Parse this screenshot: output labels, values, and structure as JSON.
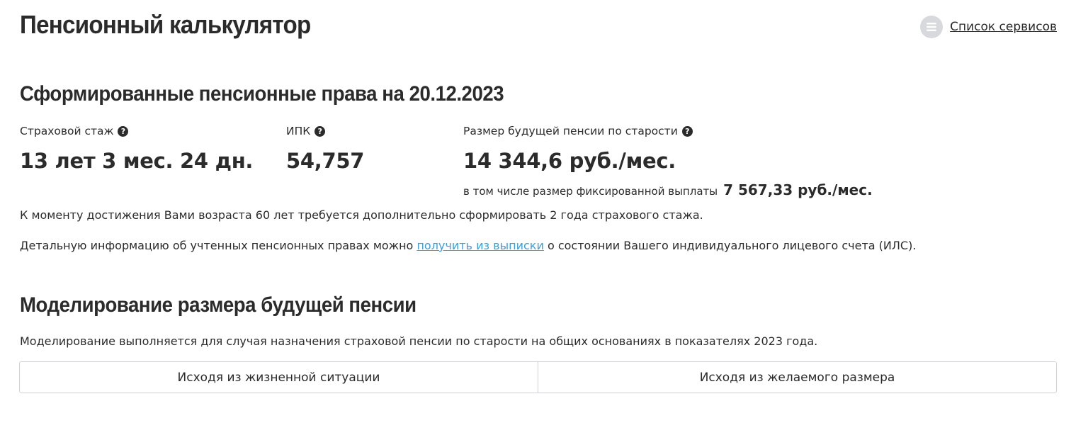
{
  "header": {
    "title": "Пенсионный калькулятор",
    "services_link": "Список сервисов",
    "services_icon": "list-icon"
  },
  "rights": {
    "title": "Сформированные пенсионные права на 20.12.2023",
    "metrics": [
      {
        "label": "Страховой стаж",
        "value": "13 лет 3 мес. 24 дн.",
        "icon": "question-icon"
      },
      {
        "label": "ИПК",
        "value": "54,757",
        "icon": "question-icon"
      },
      {
        "label": "Размер будущей пенсии по старости",
        "value": "14 344,6 руб./мес.",
        "icon": "question-icon"
      }
    ],
    "fixed_note": "в том числе размер фиксированной выплаты",
    "fixed_value": "7 567,33 руб./мес.",
    "requirement": "К моменту достижения Вами возраста 60 лет требуется дополнительно сформировать 2 года страхового стажа.",
    "details_prefix": "Детальную информацию об учтенных пенсионных правах можно",
    "details_link": "получить из выписки",
    "details_suffix": "о состоянии Вашего индивидуального лицевого счета (ИЛС)."
  },
  "modeling": {
    "title": "Моделирование размера будущей пенсии",
    "description": "Моделирование выполняется для случая назначения страховой пенсии по старости на общих основаниях в показателях 2023 года.",
    "tabs": [
      "Исходя из жизненной ситуации",
      "Исходя из желаемого размера"
    ]
  },
  "colors": {
    "text": "#2b2b2b",
    "link": "#3aa0d9",
    "border": "#cfd3d7",
    "icon_bg": "#d7d9dc"
  }
}
